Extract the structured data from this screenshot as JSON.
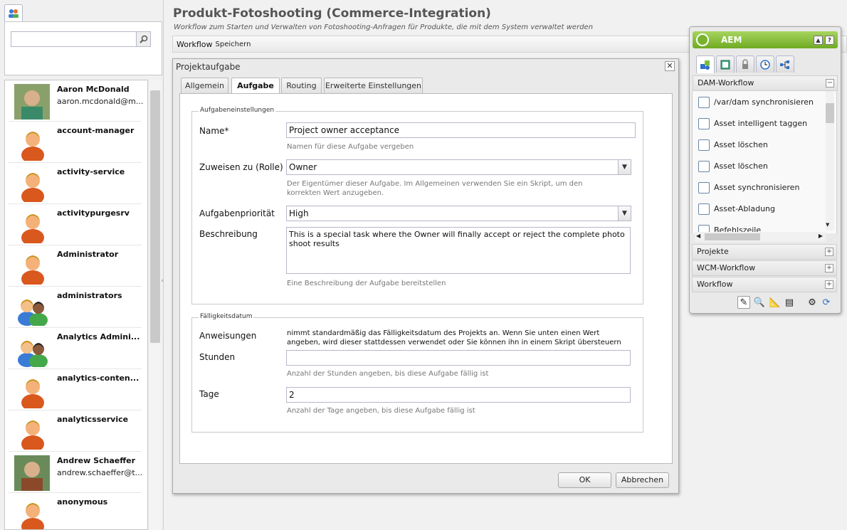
{
  "page": {
    "title": "Produkt-Fotoshooting (Commerce-Integration)",
    "subtitle": "Workflow zum Starten und Verwalten von Fotoshooting-Anfragen für Produkte, die mit dem System verwaltet werden"
  },
  "toolbar": {
    "workflow_label": "Workflow",
    "save_label": "Speichern"
  },
  "users": [
    {
      "name": "Aaron McDonald",
      "email": "aaron.mcdonald@m...",
      "avatar": "photo-avatar"
    },
    {
      "name": "account-manager",
      "email": "",
      "avatar": "user-icon"
    },
    {
      "name": "activity-service",
      "email": "",
      "avatar": "user-icon"
    },
    {
      "name": "activitypurgesrv",
      "email": "",
      "avatar": "user-icon"
    },
    {
      "name": "Administrator",
      "email": "",
      "avatar": "user-icon"
    },
    {
      "name": "administrators",
      "email": "",
      "avatar": "group-icon"
    },
    {
      "name": "Analytics Admini...",
      "email": "",
      "avatar": "group-icon"
    },
    {
      "name": "analytics-conten...",
      "email": "",
      "avatar": "user-icon"
    },
    {
      "name": "analyticsservice",
      "email": "",
      "avatar": "user-icon"
    },
    {
      "name": "Andrew Schaeffer",
      "email": "andrew.schaeffer@t...",
      "avatar": "photo-avatar"
    },
    {
      "name": "anonymous",
      "email": "",
      "avatar": "user-icon"
    }
  ],
  "dialog": {
    "title": "Projektaufgabe",
    "tabs": [
      "Allgemein",
      "Aufgabe",
      "Routing",
      "Erweiterte Einstellungen"
    ],
    "active_tab": "Aufgabe",
    "section1": {
      "legend": "Aufgabeneinstellungen",
      "name_label": "Name*",
      "name_value": "Project owner acceptance",
      "name_hint": "Namen für diese Aufgabe vergeben",
      "assign_label": "Zuweisen zu (Rolle)",
      "assign_value": "Owner",
      "assign_hint": "Der Eigentümer dieser Aufgabe. Im Allgemeinen verwenden Sie ein Skript, um den korrekten Wert anzugeben.",
      "priority_label": "Aufgabenpriorität",
      "priority_value": "High",
      "desc_label": "Beschreibung",
      "desc_value": "This is a special task where the Owner will finally accept or reject the complete photo shoot results",
      "desc_hint": "Eine Beschreibung der Aufgabe bereitstellen"
    },
    "section2": {
      "legend": "Fälligkeitsdatum",
      "instructions_label": "Anweisungen",
      "instructions_text": "nimmt standardmäßig das Fälligkeitsdatum des Projekts an. Wenn Sie unten einen Wert angeben, wird dieser stattdessen verwendet oder Sie können ihn in einem Skript übersteuern",
      "hours_label": "Stunden",
      "hours_value": "",
      "hours_hint": "Anzahl der Stunden angeben, bis diese Aufgabe fällig ist",
      "days_label": "Tage",
      "days_value": "2",
      "days_hint": "Anzahl der Tage angeben, bis diese Aufgabe fällig ist"
    },
    "ok_label": "OK",
    "cancel_label": "Abbrechen"
  },
  "sidekick": {
    "title": "AEM",
    "sections": {
      "dam": "DAM-Workflow",
      "projects": "Projekte",
      "wcm": "WCM-Workflow",
      "workflow": "Workflow"
    },
    "dam_items": [
      "/var/dam synchronisieren",
      "Asset intelligent taggen",
      "Asset löschen",
      "Asset löschen",
      "Asset synchronisieren",
      "Asset-Abladung",
      "Befehlszeile"
    ]
  },
  "colors": {
    "accent_green": "#79b32b",
    "user_orange": "#e8722a"
  }
}
